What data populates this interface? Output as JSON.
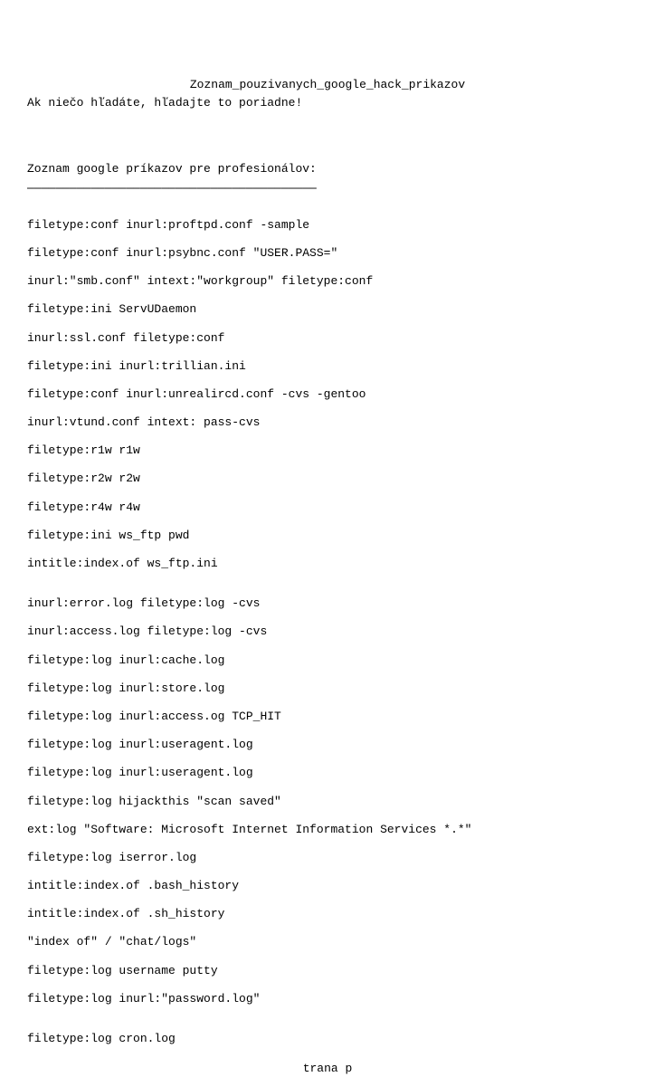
{
  "title": "Zoznam_pouzivanych_google_hack_prikazov",
  "subtitle": "Ak niečo hľadáte, hľadajte to poriadne!",
  "section_header": "Zoznam google príkazov pre profesionálov:",
  "underline": "─────────────────────────────────────────",
  "commands_block1": [
    "filetype:conf inurl:proftpd.conf -sample",
    "filetype:conf inurl:psybnc.conf \"USER.PASS=\"",
    "inurl:\"smb.conf\" intext:\"workgroup\" filetype:conf",
    "filetype:ini ServUDaemon",
    "inurl:ssl.conf filetype:conf",
    "filetype:ini inurl:trillian.ini",
    "filetype:conf inurl:unrealircd.conf -cvs -gentoo",
    "inurl:vtund.conf intext: pass-cvs",
    "filetype:r1w r1w",
    "filetype:r2w r2w",
    "filetype:r4w r4w",
    "filetype:ini ws_ftp pwd",
    "intitle:index.of ws_ftp.ini"
  ],
  "commands_block2": [
    "inurl:error.log filetype:log -cvs",
    "inurl:access.log filetype:log -cvs",
    "filetype:log inurl:cache.log",
    "filetype:log inurl:store.log",
    "filetype:log inurl:access.og TCP_HIT",
    "filetype:log inurl:useragent.log",
    "filetype:log inurl:useragent.log",
    "filetype:log hijackthis \"scan saved\"",
    "ext:log \"Software: Microsoft Internet Information Services *.*\"",
    "filetype:log iserror.log",
    "intitle:index.of .bash_history",
    "intitle:index.of .sh_history",
    "\"index of\" / \"chat/logs\"",
    "filetype:log username putty",
    "filetype:log inurl:\"password.log\""
  ],
  "commands_block3": [
    "filetype:log cron.log"
  ],
  "page_footer": "trana p"
}
